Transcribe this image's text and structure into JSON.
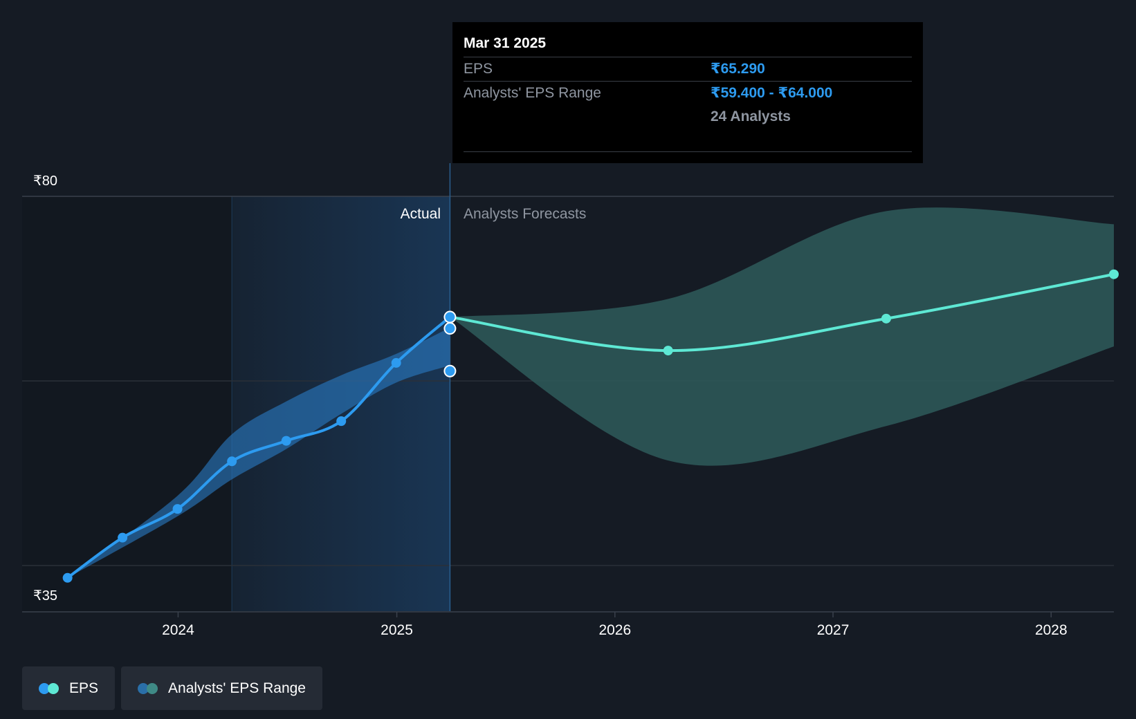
{
  "colors": {
    "background": "#151b24",
    "eps_actual": "#2d9bf0",
    "eps_forecast": "#5ee8d4",
    "actual_range": "#2a7bc4",
    "forecast_range": "#2e5a5a",
    "tooltip_value": "#2d9bf0",
    "text_muted": "#8f96a1"
  },
  "tooltip": {
    "date": "Mar 31 2025",
    "eps_label": "EPS",
    "eps_value": "₹65.290",
    "range_label": "Analysts' EPS Range",
    "range_value": "₹59.400 - ₹64.000",
    "analysts": "24 Analysts"
  },
  "legend": [
    {
      "label": "EPS",
      "colors": [
        "#2d9bf0",
        "#5ee8d4"
      ]
    },
    {
      "label": "Analysts' EPS Range",
      "colors": [
        "#2a6fa8",
        "#3f8a86"
      ]
    }
  ],
  "chart_data": {
    "type": "line",
    "title": "",
    "xlabel": "",
    "ylabel": "",
    "x_domain": [
      "2023-04-15",
      "2028-04-15"
    ],
    "ylim": [
      35,
      80
    ],
    "y_ticks": [
      {
        "value": 80,
        "label": "₹80"
      },
      {
        "value": 35,
        "label": "₹35"
      }
    ],
    "gridlines": [
      80,
      57.5,
      35
    ],
    "x_ticks": [
      {
        "date": "2024-01-01",
        "label": "2024"
      },
      {
        "date": "2025-01-01",
        "label": "2025"
      },
      {
        "date": "2026-01-01",
        "label": "2026"
      },
      {
        "date": "2027-01-01",
        "label": "2027"
      },
      {
        "date": "2028-01-01",
        "label": "2028"
      }
    ],
    "highlight_start": "2024-03-31",
    "divider_date": "2025-03-31",
    "divider_labels": {
      "left": "Actual",
      "right": "Analysts Forecasts"
    },
    "series": [
      {
        "name": "EPS",
        "role": "actual",
        "points": [
          [
            "2023-06-30",
            33.5
          ],
          [
            "2023-09-30",
            38.4
          ],
          [
            "2023-12-31",
            41.9
          ],
          [
            "2024-03-31",
            47.7
          ],
          [
            "2024-06-30",
            50.2
          ],
          [
            "2024-09-30",
            52.6
          ],
          [
            "2024-12-31",
            59.7
          ],
          [
            "2025-03-31",
            65.29
          ]
        ]
      },
      {
        "name": "EPS",
        "role": "forecast",
        "points": [
          [
            "2025-03-31",
            65.29
          ],
          [
            "2026-03-31",
            61.2
          ],
          [
            "2027-03-31",
            65.1
          ],
          [
            "2028-04-15",
            70.5
          ]
        ]
      }
    ],
    "markers": [
      {
        "date": "2025-03-31",
        "value": 63.9
      },
      {
        "date": "2025-03-31",
        "value": 58.7
      }
    ],
    "actual_range": {
      "upper": [
        [
          "2023-06-30",
          33.5
        ],
        [
          "2023-12-31",
          43.5
        ],
        [
          "2024-03-31",
          51.0
        ],
        [
          "2024-06-30",
          55.0
        ],
        [
          "2024-09-30",
          58.2
        ],
        [
          "2024-12-31",
          60.8
        ],
        [
          "2025-03-31",
          64.0
        ]
      ],
      "lower": [
        [
          "2023-06-30",
          33.5
        ],
        [
          "2023-12-31",
          41.0
        ],
        [
          "2024-03-31",
          45.5
        ],
        [
          "2024-06-30",
          49.2
        ],
        [
          "2024-09-30",
          53.5
        ],
        [
          "2024-12-31",
          57.3
        ],
        [
          "2025-03-31",
          59.4
        ]
      ]
    },
    "forecast_range": {
      "upper": [
        [
          "2025-03-31",
          65.29
        ],
        [
          "2026-03-31",
          67.5
        ],
        [
          "2027-03-31",
          78.2
        ],
        [
          "2028-04-15",
          76.6
        ]
      ],
      "lower": [
        [
          "2025-03-31",
          65.29
        ],
        [
          "2026-03-31",
          47.8
        ],
        [
          "2027-03-31",
          52.0
        ],
        [
          "2028-04-15",
          61.7
        ]
      ]
    }
  }
}
